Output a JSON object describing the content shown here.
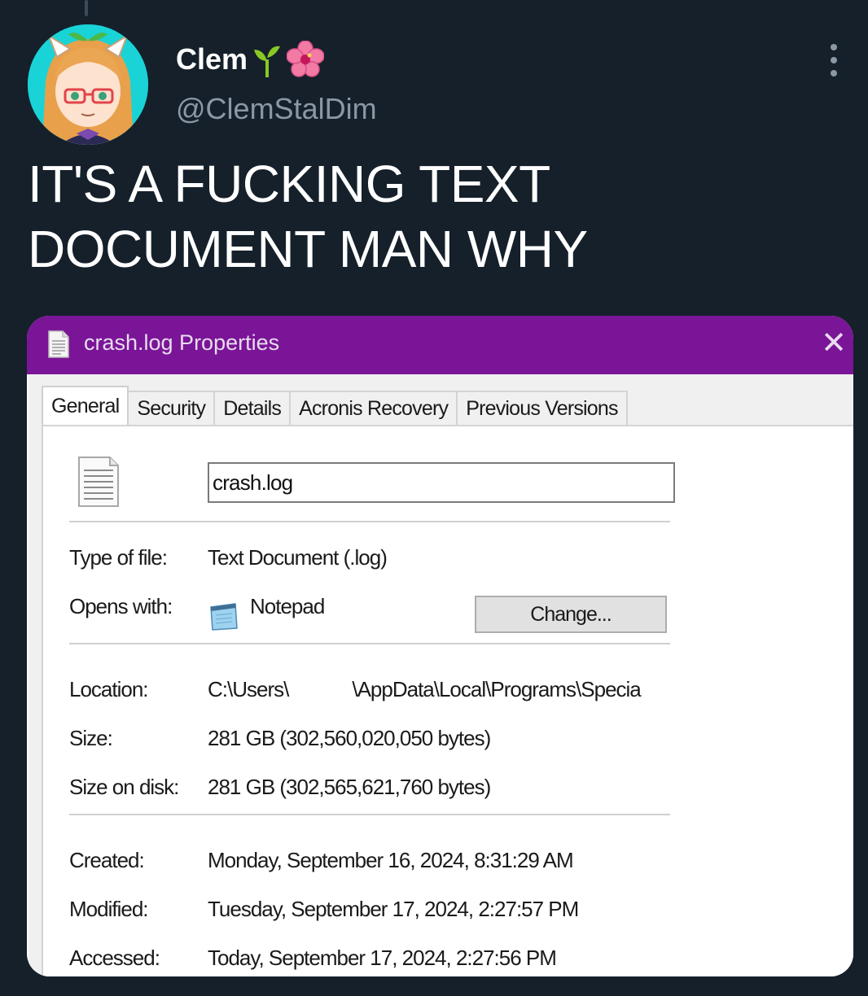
{
  "tweet": {
    "display_name": "Clem",
    "name_emojis": [
      "seedling-emoji",
      "hibiscus-emoji"
    ],
    "handle": "@ClemStalDim",
    "text": "IT'S A FUCKING TEXT DOCUMENT MAN WHY"
  },
  "dialog": {
    "title": "crash.log Properties",
    "title_bar_color": "#7a1597",
    "tabs": [
      {
        "label": "General",
        "active": true
      },
      {
        "label": "Security",
        "active": false
      },
      {
        "label": "Details",
        "active": false
      },
      {
        "label": "Acronis Recovery",
        "active": false
      },
      {
        "label": "Previous Versions",
        "active": false
      }
    ],
    "file_name": "crash.log",
    "type_label": "Type of file:",
    "type_value": "Text Document (.log)",
    "opens_label": "Opens with:",
    "opens_value": "Notepad",
    "change_button": "Change...",
    "location_label": "Location:",
    "location_part1": "C:\\Users\\",
    "location_part2": "\\AppData\\Local\\Programs\\Specia",
    "size_label": "Size:",
    "size_value": "281 GB (302,560,020,050 bytes)",
    "size_on_disk_label": "Size on disk:",
    "size_on_disk_value": "281 GB (302,565,621,760 bytes)",
    "created_label": "Created:",
    "created_value": "Monday, September 16, 2024, 8:31:29 AM",
    "modified_label": "Modified:",
    "modified_value": "Tuesday, September 17, 2024, 2:27:57 PM",
    "accessed_label": "Accessed:",
    "accessed_value": "Today, September 17, 2024, 2:27:56 PM"
  }
}
